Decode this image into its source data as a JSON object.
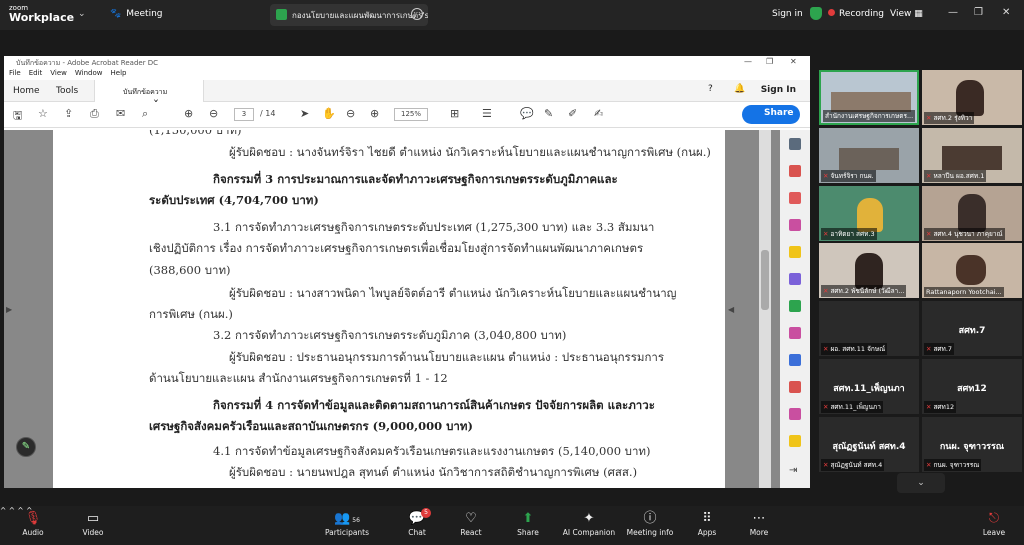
{
  "zoom": {
    "logo_small": "zoom",
    "logo_big": "Workplace",
    "meeting_label": "Meeting",
    "share_tab": "กองนโยบายและแผนพัฒนาการเกษตร's",
    "signin": "Sign in",
    "recording": "Recording",
    "view": "View",
    "accent": "#2da44e",
    "record_color": "#e03b3b"
  },
  "acrobat": {
    "title": "บันทึกข้อความ - Adobe Acrobat Reader DC",
    "menu": [
      "File",
      "Edit",
      "View",
      "Window",
      "Help"
    ],
    "tabs": {
      "home": "Home",
      "tools": "Tools",
      "doc": "บันทึกข้อความ"
    },
    "signin": "Sign In",
    "page_current": "3",
    "page_total": "/ 14",
    "zoom": "125%",
    "share": "Share",
    "share_color": "#1473e6"
  },
  "document": {
    "lines": [
      "(1,150,000 บาท)",
      "ผู้รับผิดชอบ : นางจันทร์จิรา ไชยดี ตำแหน่ง นักวิเคราะห์นโยบายและแผนชำนาญการพิเศษ (กนผ.)",
      "กิจกรรมที่ 3 การประมาณการและจัดทำภาวะเศรษฐกิจการเกษตรระดับภูมิภาคและ",
      "ระดับประเทศ (4,704,700 บาท)",
      "3.1 การจัดทำภาวะเศรษฐกิจการเกษตรระดับประเทศ (1,275,300 บาท) และ 3.3 สัมมนา",
      "เชิงปฏิบัติการ เรื่อง การจัดทำภาวะเศรษฐกิจการเกษตรเพื่อเชื่อมโยงสู่การจัดทำแผนพัฒนาภาคเกษตร",
      "(388,600 บาท)",
      "ผู้รับผิดชอบ : นางสาวพนิดา ไพบูลย์จิตต์อารี ตำแหน่ง นักวิเคราะห์นโยบายและแผนชำนาญ",
      "การพิเศษ (กนผ.)",
      "3.2 การจัดทำภาวะเศรษฐกิจการเกษตรระดับภูมิภาค (3,040,800 บาท)",
      "ผู้รับผิดชอบ : ประธานอนุกรรมการด้านนโยบายและแผน ตำแหน่ง : ประธานอนุกรรมการ",
      "ด้านนโยบายและแผน สำนักงานเศรษฐกิจการเกษตรที่ 1 - 12",
      "กิจกรรมที่ 4 การจัดทำข้อมูลและติดตามสถานการณ์สินค้าเกษตร ปัจจัยการผลิต และภาวะ",
      "เศรษฐกิจสังคมครัวเรือนและสถาบันเกษตรกร (9,000,000 บาท)",
      "4.1 การจัดทำข้อมูลเศรษฐกิจสังคมครัวเรือนเกษตรและแรงงานเกษตร (5,140,000 บาท)",
      "ผู้รับผิดชอบ : นายนพปฎล สุทนต์ ตำแหน่ง นักวิชาการสถิติชำนาญการพิเศษ (ศสส.)"
    ]
  },
  "participants": [
    {
      "label": "สำนักงานเศรษฐกิจการเกษตร...",
      "video": true
    },
    {
      "label": "สศท.2 รุ่งทิวา",
      "video": true
    },
    {
      "label": "จันทร์จิรา กนผ.",
      "video": true
    },
    {
      "label": "หลาปีน ผอ.สศท.1",
      "video": true
    },
    {
      "label": "อาทิตยา สศท.3",
      "video": true
    },
    {
      "label": "สศท.4 นุชวนา ภาคุยาณ์",
      "video": true
    },
    {
      "label": "สศท.2 พัชนีลักษ์ (วัฒีลา...",
      "video": true
    },
    {
      "label": "Rattanaporn Yootchai...",
      "video": true
    },
    {
      "label": "ผอ. สศท.11 จักษณ์",
      "name": "",
      "video": false
    },
    {
      "label": "สศท.7",
      "name": "สศท.7",
      "video": false
    },
    {
      "label": "สศท.11_เพ็ญนภา",
      "name": "สศท.11_เพ็ญนภา",
      "video": false
    },
    {
      "label": "สศท12",
      "name": "สศท12",
      "video": false
    },
    {
      "label": "สุณัฏฐนันท์ สศท.4",
      "name": "สุณัฏฐนันท์ สศท.4",
      "video": false
    },
    {
      "label": "กนผ. จุฑาวรรณ",
      "name": "กนผ. จุฑาวรรณ",
      "video": false
    }
  ],
  "toolbar": {
    "audio": "Audio",
    "video": "Video",
    "participants": "Participants",
    "participants_count": "56",
    "chat": "Chat",
    "chat_badge": "5",
    "react": "React",
    "share": "Share",
    "ai": "AI Companion",
    "meeting_info": "Meeting info",
    "apps": "Apps",
    "more": "More",
    "leave": "Leave",
    "share_color": "#2da44e",
    "leave_color": "#e03b3b"
  }
}
